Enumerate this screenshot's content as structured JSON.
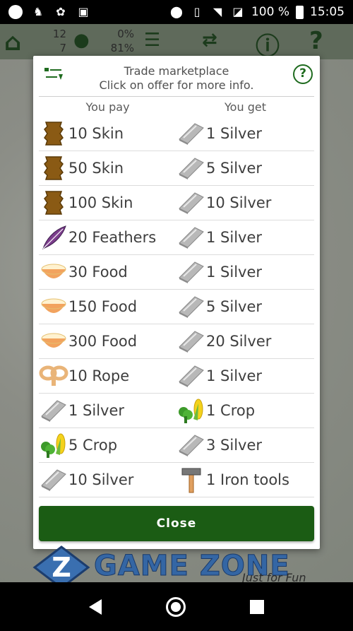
{
  "status_bar": {
    "battery_text": "100 %",
    "time": "15:05"
  },
  "app_bar": {
    "stats_left": [
      "12",
      "7"
    ],
    "stats_right": [
      "0%",
      "81%"
    ]
  },
  "dialog": {
    "title_line1": "Trade marketplace",
    "title_line2": "Click on offer for more info.",
    "col_pay": "You pay",
    "col_get": "You get",
    "close_label": "Close",
    "offers": [
      {
        "pay": "10 Skin",
        "pay_icon": "skin-icon",
        "get": "1 Silver",
        "get_icon": "silver-icon"
      },
      {
        "pay": "50 Skin",
        "pay_icon": "skin-icon",
        "get": "5 Silver",
        "get_icon": "silver-icon"
      },
      {
        "pay": "100 Skin",
        "pay_icon": "skin-icon",
        "get": "10 Silver",
        "get_icon": "silver-icon"
      },
      {
        "pay": "20 Feathers",
        "pay_icon": "feather-icon",
        "get": "1 Silver",
        "get_icon": "silver-icon"
      },
      {
        "pay": "30 Food",
        "pay_icon": "food-icon",
        "get": "1 Silver",
        "get_icon": "silver-icon"
      },
      {
        "pay": "150 Food",
        "pay_icon": "food-icon",
        "get": "5 Silver",
        "get_icon": "silver-icon"
      },
      {
        "pay": "300 Food",
        "pay_icon": "food-icon",
        "get": "20 Silver",
        "get_icon": "silver-icon"
      },
      {
        "pay": "10 Rope",
        "pay_icon": "rope-icon",
        "get": "1 Silver",
        "get_icon": "silver-icon"
      },
      {
        "pay": "1 Silver",
        "pay_icon": "silver-icon",
        "get": "1 Crop",
        "get_icon": "crop-icon"
      },
      {
        "pay": "5 Crop",
        "pay_icon": "crop-icon",
        "get": "3 Silver",
        "get_icon": "silver-icon"
      },
      {
        "pay": "10 Silver",
        "pay_icon": "silver-icon",
        "get": "1 Iron tools",
        "get_icon": "iron-tools-icon"
      }
    ]
  },
  "watermark": {
    "brand": "GAME ZONE",
    "tagline": "Just for Fun"
  },
  "colors": {
    "primary_green": "#1b5c14",
    "help_green": "#1f6b1f",
    "text_gray": "#3e3e3e"
  }
}
